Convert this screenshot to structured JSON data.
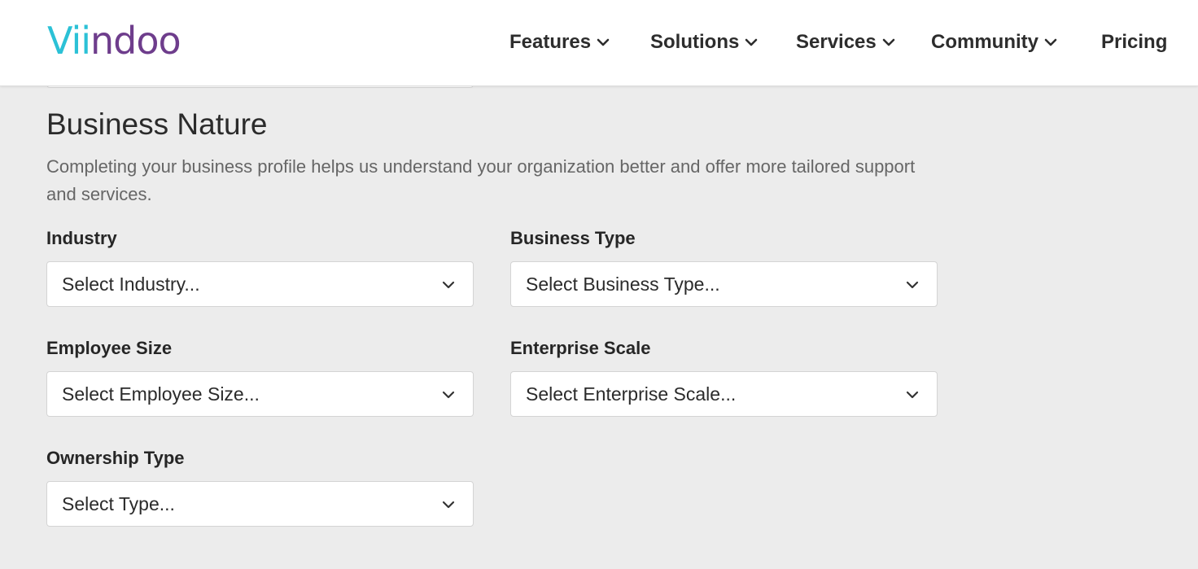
{
  "header": {
    "logo_part1": "Vi",
    "logo_part2": "ndoo",
    "logo_i2": "i",
    "nav": [
      {
        "label": "Features",
        "has_dropdown": true
      },
      {
        "label": "Solutions",
        "has_dropdown": true
      },
      {
        "label": "Services",
        "has_dropdown": true
      },
      {
        "label": "Community",
        "has_dropdown": true
      },
      {
        "label": "Pricing",
        "has_dropdown": false
      }
    ]
  },
  "section": {
    "title": "Business Nature",
    "description": "Completing your business profile helps us understand your organization better and offer more tailored support and services."
  },
  "fields": {
    "industry": {
      "label": "Industry",
      "placeholder": "Select Industry..."
    },
    "business_type": {
      "label": "Business Type",
      "placeholder": "Select Business Type..."
    },
    "employee_size": {
      "label": "Employee Size",
      "placeholder": "Select Employee Size..."
    },
    "enterprise_scale": {
      "label": "Enterprise Scale",
      "placeholder": "Select Enterprise Scale..."
    },
    "ownership_type": {
      "label": "Ownership Type",
      "placeholder": "Select Type..."
    }
  },
  "colors": {
    "logo_cyan": "#2bc1d6",
    "logo_purple": "#6e3d8c",
    "page_background": "#ececec"
  }
}
